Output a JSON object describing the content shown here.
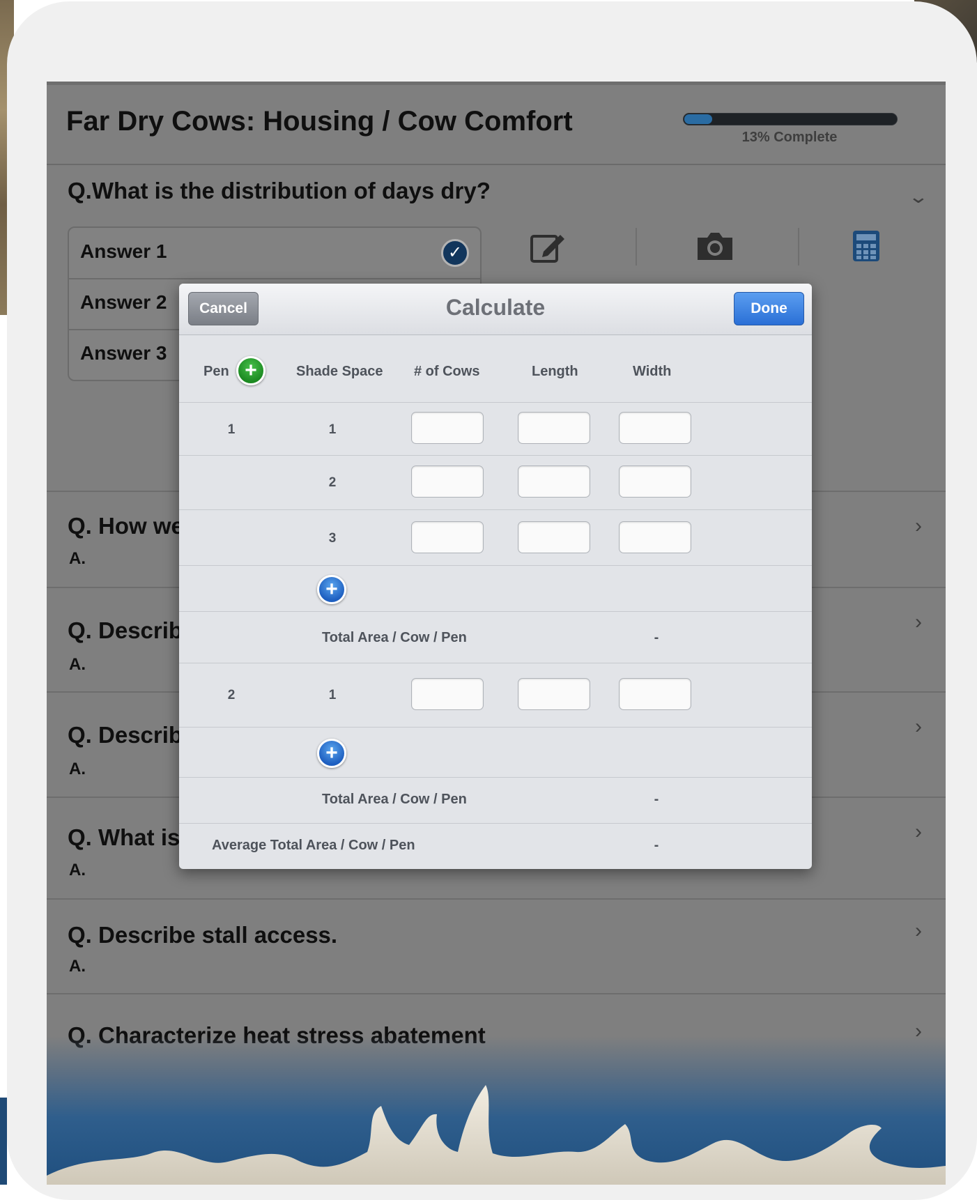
{
  "header": {
    "title": "Far Dry Cows: Housing / Cow Comfort",
    "progress_fraction": 0.13,
    "progress_label": "13% Complete"
  },
  "current_question": {
    "text": "Q.What is the distribution of days dry?",
    "answers": [
      "Answer 1",
      "Answer 2",
      "Answer 3"
    ],
    "selected_answer_index": 0
  },
  "tools": [
    "edit-note-icon",
    "camera-icon",
    "calculator-icon"
  ],
  "questions": [
    {
      "q": "Q. How we",
      "a": "A."
    },
    {
      "q": "Q. Describ",
      "a": "A."
    },
    {
      "q": "Q. Describ",
      "a": "A."
    },
    {
      "q": "Q. What is",
      "a": "A."
    },
    {
      "q": "Q. Describe stall access.",
      "a": "A."
    },
    {
      "q": "Q. Characterize heat stress abatement",
      "a": ""
    }
  ],
  "modal": {
    "title": "Calculate",
    "cancel_label": "Cancel",
    "done_label": "Done",
    "columns": [
      "Pen",
      "Shade Space",
      "# of Cows",
      "Length",
      "Width"
    ],
    "pens": [
      {
        "pen": "1",
        "spaces": [
          "1",
          "2",
          "3"
        ],
        "total_label": "Total Area / Cow / Pen",
        "total_value": "-"
      },
      {
        "pen": "2",
        "spaces": [
          "1"
        ],
        "total_label": "Total Area / Cow / Pen",
        "total_value": "-"
      }
    ],
    "average_label": "Average Total Area / Cow / Pen",
    "average_value": "-"
  },
  "colors": {
    "accent_blue": "#2a6fd6",
    "add_green": "#1c8a22",
    "progress_fill": "#2a6ca3"
  }
}
